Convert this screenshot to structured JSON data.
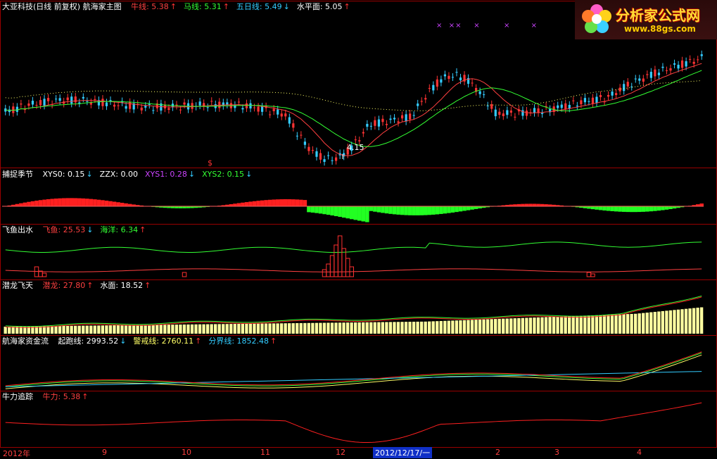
{
  "colors": {
    "up": "#ff3333",
    "down": "#33ccff",
    "panel_border": "#990000",
    "cash": "#ffffa0"
  },
  "logo": {
    "title": "分析家公式网",
    "url": "www.88gs.com"
  },
  "panel_main": {
    "title": "大亚科技(日线 前复权) 航海家主图",
    "items": [
      {
        "label": "牛线: 5.38",
        "color": "#ff4040",
        "arrow": "↑"
      },
      {
        "label": "马线: 5.31",
        "color": "#33ff33",
        "arrow": "↑"
      },
      {
        "label": "五日线: 5.49",
        "color": "#33ccff",
        "arrow": "↓"
      },
      {
        "label": "水平面: 5.05",
        "color": "#ffffff",
        "arrow": "↑"
      }
    ],
    "low_label": "4.15",
    "dollar_mark": "$"
  },
  "panel_2": {
    "title": "捕捉季节",
    "items": [
      {
        "label": "XYS0: 0.15",
        "color": "#ffffff",
        "arrow": "↓"
      },
      {
        "label": "ZZX: 0.00",
        "color": "#ffffff",
        "arrow": ""
      },
      {
        "label": "XYS1: 0.28",
        "color": "#cc44ff",
        "arrow": "↓"
      },
      {
        "label": "XYS2: 0.15",
        "color": "#33ff33",
        "arrow": "↓"
      }
    ]
  },
  "panel_3": {
    "title": "飞鱼出水",
    "items": [
      {
        "label": "飞鱼: 25.53",
        "color": "#ff4040",
        "arrow": "↓"
      },
      {
        "label": "海洋: 6.34",
        "color": "#33ff33",
        "arrow": "↑"
      }
    ]
  },
  "panel_4": {
    "title": "潜龙飞天",
    "items": [
      {
        "label": "潜龙: 27.80",
        "color": "#ff4040",
        "arrow": "↑"
      },
      {
        "label": "水面: 18.52",
        "color": "#ffffff",
        "arrow": "↑"
      }
    ]
  },
  "panel_5": {
    "title": "航海家资金流",
    "items": [
      {
        "label": "起跑线: 2993.52",
        "color": "#ffffff",
        "arrow": "↓"
      },
      {
        "label": "警戒线: 2760.11",
        "color": "#ffff66",
        "arrow": "↑"
      },
      {
        "label": "分界线: 1852.48",
        "color": "#33ccff",
        "arrow": "↑"
      }
    ]
  },
  "panel_6": {
    "title": "牛力追踪",
    "items": [
      {
        "label": "牛力: 5.38",
        "color": "#ff4040",
        "arrow": "↑"
      }
    ]
  },
  "x_axis": {
    "ticks": [
      "2012年",
      "9",
      "10",
      "11",
      "12",
      "2",
      "3",
      "4"
    ],
    "highlight": "2012/12/17/一"
  }
}
